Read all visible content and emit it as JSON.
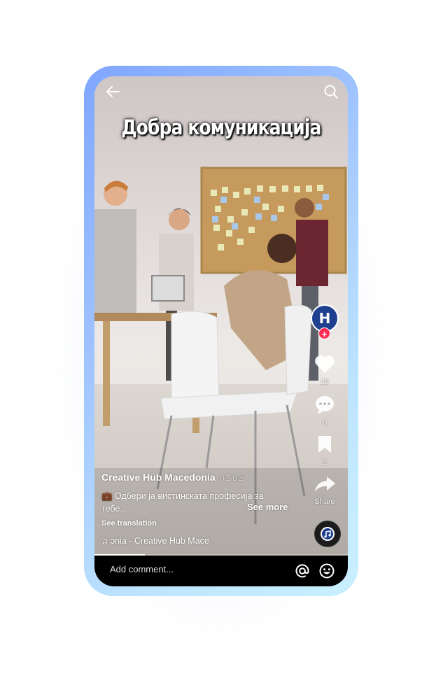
{
  "video": {
    "overlay_title": "Добра комуникација"
  },
  "author": {
    "username": "Creative Hub Macedonia",
    "date": "02-02",
    "avatar_initials": "H"
  },
  "caption": {
    "text": "💼 Одбери ја вистинската професија за тебе...",
    "see_more": "See more",
    "see_translation": "See translation"
  },
  "music": {
    "label": "♫ ɔnia - Creative Hub Mace"
  },
  "actions": {
    "likes": "35",
    "comments": "0",
    "saves": "1",
    "share_label": "Share"
  },
  "comment_bar": {
    "placeholder": "Add comment..."
  },
  "progress": {
    "played_fraction": 0.2
  },
  "colors": {
    "frame_gradient_start": "#7fa6ff",
    "frame_gradient_end": "#c9f0ff",
    "follow_badge": "#fe2c55",
    "avatar_bg": "#1f3f8f",
    "comment_bar_bg": "#000000"
  },
  "icons": {
    "back": "back-arrow-icon",
    "search": "search-icon",
    "like": "heart-icon",
    "comment": "comment-bubble-icon",
    "save": "bookmark-icon",
    "share": "share-arrow-icon",
    "mention": "at-sign-icon",
    "emoji": "smiley-icon",
    "music": "music-note-icon"
  }
}
